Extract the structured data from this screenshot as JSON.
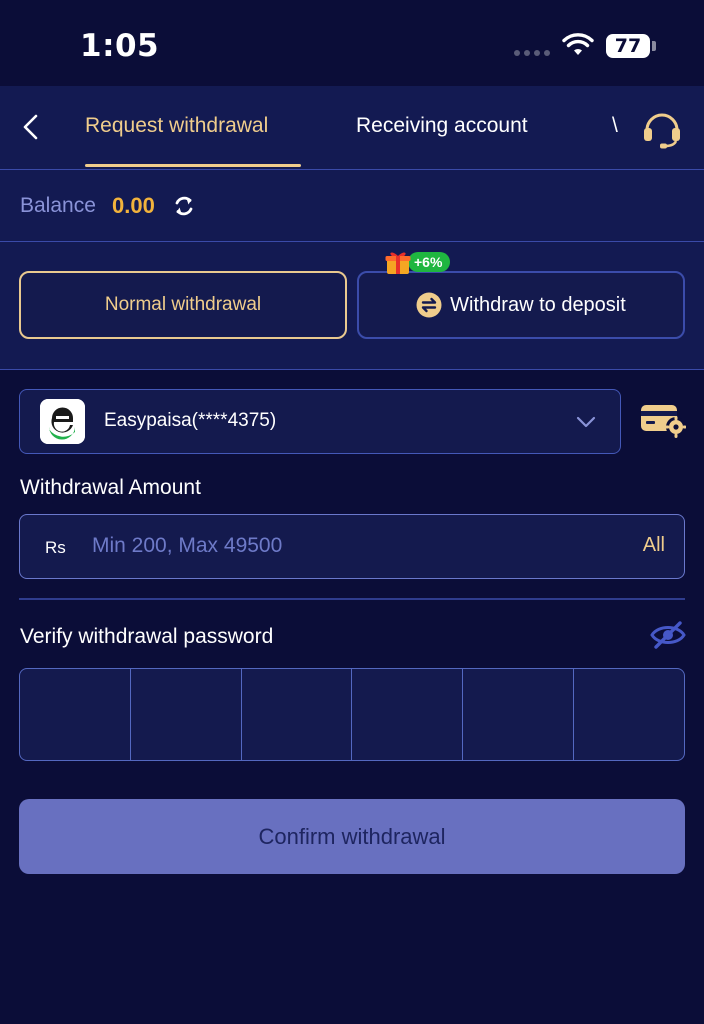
{
  "status_bar": {
    "time": "1:05",
    "battery": "77"
  },
  "nav": {
    "tabs": [
      {
        "label": "Request withdrawal",
        "active": true
      },
      {
        "label": "Receiving account",
        "active": false
      },
      {
        "label": "\\",
        "active": false
      }
    ],
    "icons": [
      "back-chevron-icon",
      "headset-support-icon"
    ]
  },
  "balance": {
    "label": "Balance",
    "value": "0.00"
  },
  "withdraw_types": {
    "normal_label": "Normal withdrawal",
    "deposit_label": "Withdraw to deposit",
    "bonus": "+6%"
  },
  "account": {
    "name": "Easypaisa(****4375)"
  },
  "amount": {
    "label": "Withdrawal Amount",
    "currency": "Rs",
    "placeholder": "Min 200, Max 49500",
    "all_label": "All"
  },
  "password": {
    "label": "Verify withdrawal password",
    "digits": 6
  },
  "confirm_label": "Confirm withdrawal",
  "colors": {
    "background": "#0b0d38",
    "panel": "#131a52",
    "accent_gold": "#f0cd8c",
    "balance_orange": "#f2b33c",
    "confirm_button": "#6870c0",
    "bonus_green": "#1fb640"
  }
}
